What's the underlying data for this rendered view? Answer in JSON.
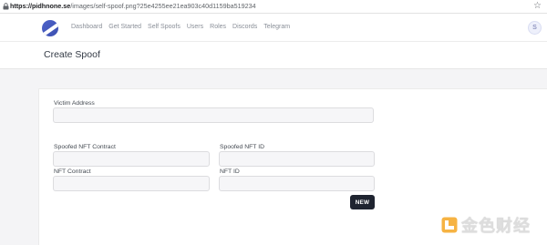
{
  "browser": {
    "url_host": "https://pidhnone.se",
    "url_path": "/images/self-spoof.png?25e4255ee21ea903c40d1159ba519234",
    "star_icon": "star-icon"
  },
  "nav": {
    "logo_icon": "app-logo",
    "links": [
      "Dashboard",
      "Get Started",
      "Self Spoofs",
      "Users",
      "Roles",
      "Discords",
      "Telegram"
    ],
    "avatar_initial": "S"
  },
  "page": {
    "title": "Create Spoof"
  },
  "form": {
    "victim_address": {
      "label": "Victim Address",
      "value": ""
    },
    "spoofed_nft_contract": {
      "label": "Spoofed NFT Contract",
      "value": ""
    },
    "spoofed_nft_id": {
      "label": "Spoofed NFT ID",
      "value": ""
    },
    "nft_contract": {
      "label": "NFT Contract",
      "value": ""
    },
    "nft_id": {
      "label": "NFT ID",
      "value": ""
    },
    "new_button_label": "NEW"
  },
  "watermark": {
    "text": "金色财经",
    "accent_color": "#f5a623"
  }
}
